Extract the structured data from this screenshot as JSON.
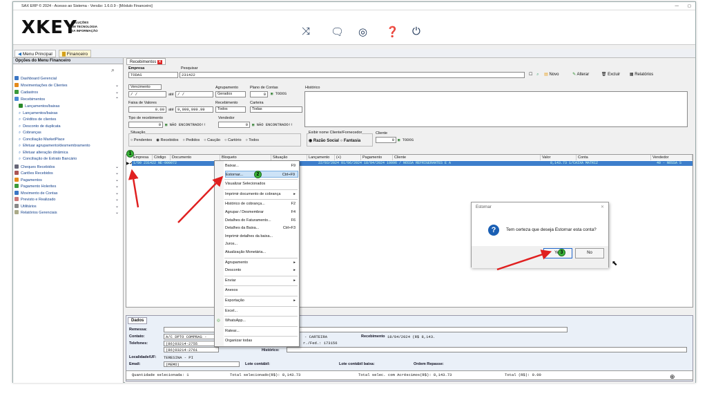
{
  "window": {
    "title": "SAX ERP © 2024 - Acesso ao Sistema - Versão: 1.6.0.9 - [Módulo Financeiro]",
    "minimize": "—",
    "restore": "▢"
  },
  "logo": {
    "name": "XKEY",
    "line1": "SOLUÇÕES",
    "line2": "EM TECNOLOGIA",
    "line3": "DA INFORMAÇÃO"
  },
  "menubar": {
    "menu_principal": "Menu Principal",
    "financeiro": "Financeiro",
    "tab_recebimentos": "Recebimentos"
  },
  "left_panel": {
    "title": "Opções do Menu Financeiro",
    "items": [
      {
        "label": "Dashboard Gerencial",
        "chev": ""
      },
      {
        "label": "Movimentações de Clientes",
        "chev": "⌄"
      },
      {
        "label": "Cadastros",
        "chev": "⌄"
      },
      {
        "label": "Recebimentos",
        "chev": "⌃"
      }
    ],
    "sub_items": [
      "Lançamentos/baixas",
      "Lançamentos/baixas",
      "Créditos de clientes",
      "Desconto de duplicata",
      "Cobranças",
      "Conciliação MarketPlace",
      "Efetuar agrupamento/desmembramento",
      "Efetuar alteração dinâmica",
      "Conciliação de Extrato Bancário"
    ],
    "items2": [
      "Cheques Recebidos",
      "Cartões Recebidos",
      "Pagamentos",
      "Pagamento Holerites",
      "Movimento de Contas",
      "Previsto e Realizado",
      "Utilitários",
      "Relatórios Gerenciais"
    ]
  },
  "form": {
    "empresa_label": "Empresa",
    "empresa_value": "TODAS",
    "pesquisar_label": "Pesquisar",
    "pesquisar_value": "231422",
    "vencimento_label": "Vencimento",
    "date_placeholder": "  /  /",
    "ate": "até",
    "agrupamento_label": "Agrupamento",
    "agrupamento_value": "Gerados",
    "plano_label": "Plano de Contas",
    "plano_value": "0",
    "todos": "TODOS",
    "historico_label": "Histórico",
    "faixa_label": "Faixa de Valores",
    "faixa_from": "0.00",
    "faixa_to": "9,999,999.99",
    "recebimento_label": "Recebimento",
    "recebimento_value": "Todos",
    "carteira_label": "Carteira",
    "carteira_value": "Todas",
    "tipo_label": "Tipo de recebimento",
    "tipo_value": "0",
    "nao_encontrado": "NÃO ENCONTRADO!!",
    "vendedor_label": "Vendedor",
    "vendedor_value": "0",
    "situacao_label": "Situação",
    "situacao_options": [
      "Pendentes",
      "Recebidos",
      "Pedidos",
      "Caução",
      "Cartório",
      "Todos"
    ],
    "exibir_label": "Exibir nome Cliente/Fornecedor",
    "razao": "Razão Social",
    "fantasia": "Fantasia",
    "cliente_label": "Cliente",
    "cliente_value": "0",
    "cliente_todos": "TODOS"
  },
  "toolbar": {
    "novo": "Novo",
    "alterar": "Alterar",
    "excluir": "Excluir",
    "relatorios": "Relatórios"
  },
  "grid": {
    "headers": [
      "Empresa",
      "Código",
      "Documento",
      "Bloqueto",
      "Situação",
      "Lançamento",
      "(+) Vencimento",
      "Pagamento",
      "Cliente",
      "Valor",
      "Conta",
      "Vendedor"
    ],
    "row_left": "1/00      231422 NE-000072",
    "row_mid": "22/03/2024 01/06/2024 18/04/2024 10096 / NOSSA REFRIGERANTES E A",
    "row_right": "8,143.73 1/CAIXA MATRIZ",
    "row_far": "40 - NOSSA S"
  },
  "context_menu": [
    {
      "label": "Baixar...",
      "shortcut": "F9"
    },
    {
      "label": "Estornar...",
      "shortcut": "Ctrl+F9"
    },
    {
      "label": "Visualizar Selecionados",
      "shortcut": ""
    },
    {
      "label": "Imprimir documento de cobrança",
      "shortcut": "▸"
    },
    {
      "label": "Histórico de cobrança...",
      "shortcut": "F2"
    },
    {
      "label": "Agrupar / Desmembrar",
      "shortcut": "F4"
    },
    {
      "label": "Detalhes do Faturamento...",
      "shortcut": "F6"
    },
    {
      "label": "Detalhes da Baixa...",
      "shortcut": "Ctrl+F3"
    },
    {
      "label": "Imprimir detalhes da baixa...",
      "shortcut": ""
    },
    {
      "label": "Juros...",
      "shortcut": ""
    },
    {
      "label": "Atualização Monetária...",
      "shortcut": ""
    },
    {
      "label": "Agrupamento",
      "shortcut": "▸"
    },
    {
      "label": "Desconto",
      "shortcut": "▸"
    },
    {
      "label": "Enviar",
      "shortcut": "▸"
    },
    {
      "label": "Anexos",
      "shortcut": ""
    },
    {
      "label": "Exportação",
      "shortcut": "▸"
    },
    {
      "label": "Excel...",
      "shortcut": ""
    },
    {
      "label": "WhatsApp...",
      "shortcut": ""
    },
    {
      "label": "Ratear...",
      "shortcut": ""
    },
    {
      "label": "Organizar todas",
      "shortcut": ""
    }
  ],
  "dialog": {
    "title": "Estornar",
    "message": "Tem certeza que deseja Estornar esta conta?",
    "yes": "Yes",
    "no": "No",
    "close": "✕"
  },
  "badges": {
    "b1": "1",
    "b2": "2",
    "b3": "3"
  },
  "dados": {
    "tab": "Dados",
    "remessa_label": "Remessa:",
    "contato_label": "Contato:",
    "contato_value": "A/C DPTO COMPRAS -",
    "carteira_text": "- CARTEIRA",
    "recebimento_label": "Recebimento",
    "recebimento_value": "18/04/2024 (R$ 8,143.",
    "telefones_label": "Telefones:",
    "tel1": "(86)03214-2755",
    "tel2": "(86)03214-2761",
    "insc_text": "r./Fed.: 173156",
    "historico_label": "Histórico:",
    "localidade_label": "Localidade/UF:",
    "localidade_value": "TERESINA - PI",
    "email_label": "Email:",
    "email_value": "(MEMO)",
    "lote_label": "Lote contábil:",
    "lote_baixa_label": "Lote contábil baixa:",
    "ordem_label": "Ordem Repasse:"
  },
  "status": {
    "qtd": "Quantidade selecionada: 1",
    "total_sel": "Total selecionado(R$): 8,143.73",
    "total_acr": "Total selec. com Acréscimos(R$): 8,143.73",
    "total": "Total (R$): 0.00"
  },
  "colors": {
    "accent": "#3d7ecb",
    "arrow": "#e02020",
    "badge": "#3bb33b",
    "header_icons": "#1d3557"
  }
}
